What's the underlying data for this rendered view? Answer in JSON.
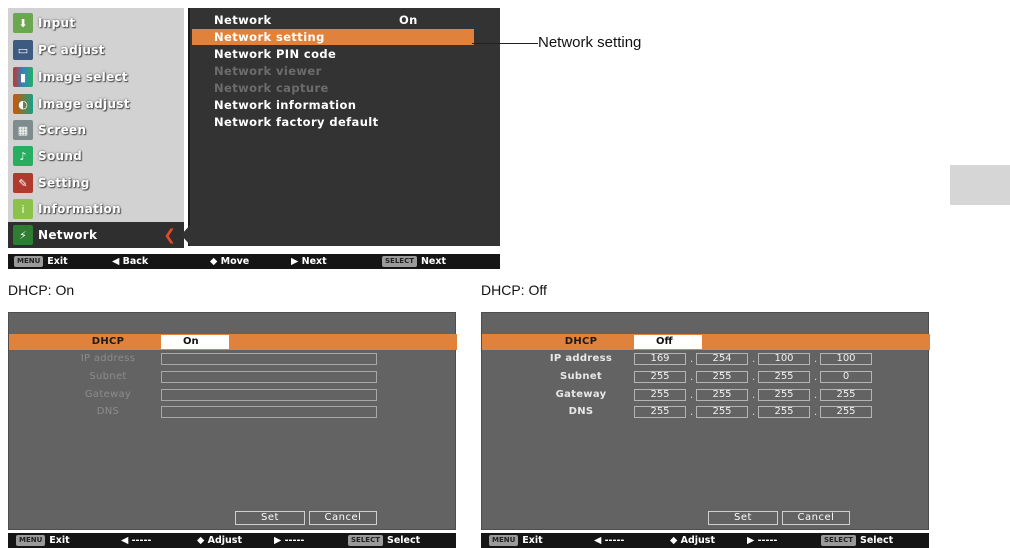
{
  "menu": {
    "left_items": [
      {
        "label": "Input",
        "icon": "input-icon",
        "color": "#6aa84f"
      },
      {
        "label": "PC adjust",
        "icon": "pc-adjust-icon",
        "color": "#3d5a80"
      },
      {
        "label": "Image select",
        "icon": "image-select-icon",
        "color": "#c0392b"
      },
      {
        "label": "Image adjust",
        "icon": "image-adjust-icon",
        "color": "#d35400"
      },
      {
        "label": "Screen",
        "icon": "screen-icon",
        "color": "#7f8c8d"
      },
      {
        "label": "Sound",
        "icon": "sound-icon",
        "color": "#27ae60"
      },
      {
        "label": "Setting",
        "icon": "setting-icon",
        "color": "#b03a2e"
      },
      {
        "label": "Information",
        "icon": "information-icon",
        "color": "#8bc34a"
      },
      {
        "label": "Network",
        "icon": "network-icon",
        "color": "#2e7d32"
      }
    ],
    "right_items": [
      {
        "label": "Network",
        "value": "On",
        "state": "normal"
      },
      {
        "label": "Network setting",
        "value": "",
        "state": "highlight"
      },
      {
        "label": "Network PIN code",
        "value": "",
        "state": "normal"
      },
      {
        "label": "Network viewer",
        "value": "",
        "state": "dim"
      },
      {
        "label": "Network capture",
        "value": "",
        "state": "dim"
      },
      {
        "label": "Network information",
        "value": "",
        "state": "normal"
      },
      {
        "label": "Network factory default",
        "value": "",
        "state": "normal"
      }
    ],
    "footer": {
      "menu_key": "MENU",
      "exit": "Exit",
      "back": "◀ Back",
      "move": "◆ Move",
      "next": "▶ Next",
      "select_key": "SELECT",
      "select_next": "Next"
    }
  },
  "annotation": "Network setting",
  "captions": {
    "left": "DHCP: On",
    "right": "DHCP: Off"
  },
  "dhcp_on": {
    "dhcp_label": "DHCP",
    "dhcp_value": "On",
    "fields": [
      "IP address",
      "Subnet",
      "Gateway",
      "DNS"
    ],
    "set": "Set",
    "cancel": "Cancel"
  },
  "dhcp_off": {
    "dhcp_label": "DHCP",
    "dhcp_value": "Off",
    "fields": [
      {
        "label": "IP address",
        "octets": [
          "169",
          "254",
          "100",
          "100"
        ]
      },
      {
        "label": "Subnet",
        "octets": [
          "255",
          "255",
          "255",
          "0"
        ]
      },
      {
        "label": "Gateway",
        "octets": [
          "255",
          "255",
          "255",
          "255"
        ]
      },
      {
        "label": "DNS",
        "octets": [
          "255",
          "255",
          "255",
          "255"
        ]
      }
    ],
    "set": "Set",
    "cancel": "Cancel"
  },
  "dialog_footer": {
    "menu_key": "MENU",
    "exit": "Exit",
    "left": "◀ -----",
    "adjust": "◆ Adjust",
    "right": "▶ -----",
    "select_key": "SELECT",
    "select": "Select"
  },
  "colors": {
    "accent": "#e0823c",
    "panel_dark": "#333333",
    "panel_light": "#d2d2d2"
  }
}
